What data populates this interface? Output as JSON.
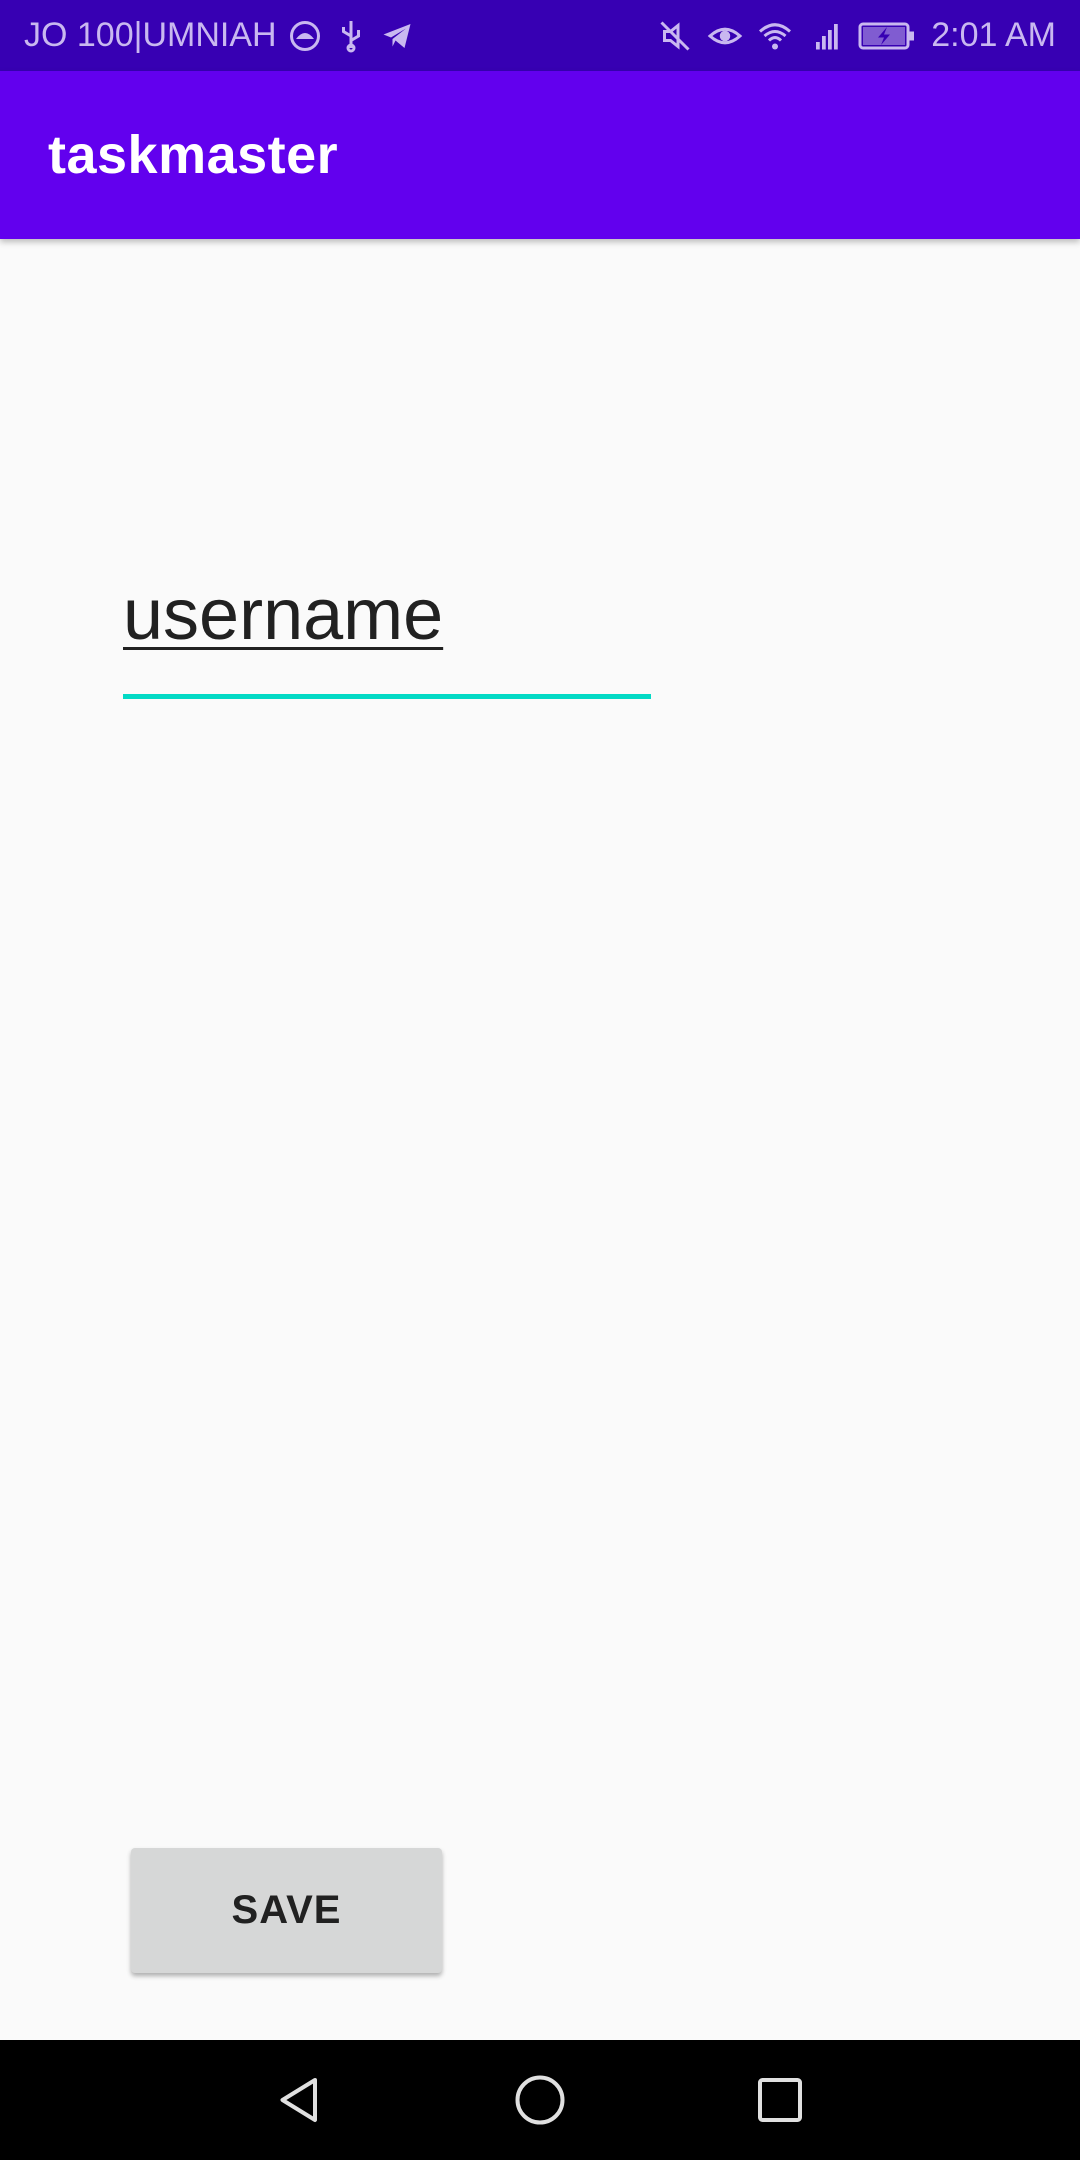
{
  "status_bar": {
    "carrier": "JO 100|UMNIAH",
    "time": "2:01 AM",
    "left_icons": [
      "circle-logo-icon",
      "usb-icon",
      "telegram-icon"
    ],
    "right_icons": [
      "mute-icon",
      "eye-icon",
      "wifi-icon",
      "4g-signal-icon",
      "battery-charging-icon"
    ]
  },
  "app_bar": {
    "title": "taskmaster"
  },
  "form": {
    "username_value": "username"
  },
  "actions": {
    "save_label": "SAVE"
  },
  "nav_bar": {
    "buttons": [
      "back-icon",
      "home-icon",
      "recents-icon"
    ]
  },
  "colors": {
    "status_bar": "#3700b3",
    "app_bar": "#6200ee",
    "accent": "#03dac5",
    "button_bg": "#d6d7d7",
    "background": "#fafafa"
  }
}
